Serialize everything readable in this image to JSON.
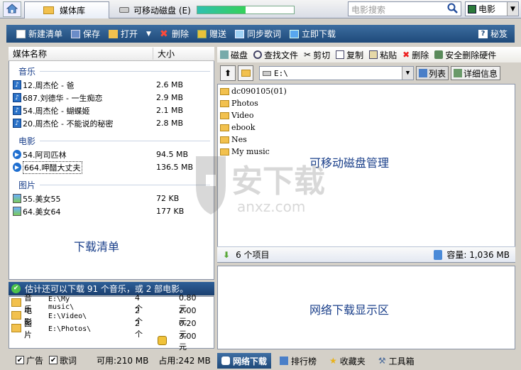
{
  "topbar": {
    "tab_library": "媒体库",
    "tab_disk": "可移动磁盘 (E)",
    "disk_usage_fraction": 0.5,
    "search_placeholder": "电影搜索",
    "category": "电影"
  },
  "toolbar": {
    "new_list": "新建清单",
    "save": "保存",
    "open": "打开",
    "delete": "删除",
    "gift": "赠送",
    "sync_lyrics": "同步歌词",
    "download_now": "立即下载",
    "tips": "秘笈"
  },
  "list": {
    "col_name": "媒体名称",
    "col_size": "大小",
    "sections": [
      {
        "title": "音乐",
        "items": [
          {
            "name": "12.周杰伦 - 爸",
            "size": "2.6 MB"
          },
          {
            "name": "687.刘德华 - 一生痴恋",
            "size": "2.9 MB"
          },
          {
            "name": "54.周杰伦 - 蝴蝶姬",
            "size": "2.1 MB"
          },
          {
            "name": "20.周杰伦 - 不能说的秘密",
            "size": "2.8 MB"
          }
        ]
      },
      {
        "title": "电影",
        "items": [
          {
            "name": "54.阿司匹林",
            "size": "94.5 MB"
          },
          {
            "name": "664.呷醋大丈夫",
            "size": "136.5 MB"
          }
        ]
      },
      {
        "title": "图片",
        "items": [
          {
            "name": "55.美女55",
            "size": "72 KB"
          },
          {
            "name": "64.美女64",
            "size": "177 KB"
          }
        ]
      }
    ],
    "area_label": "下载清单"
  },
  "estimate": {
    "text": "估计还可以下载 91 个音乐，或 2 部电影。",
    "rows": [
      {
        "type": "音乐",
        "path": "E:\\My music\\",
        "count": "4 个",
        "price": "0.80 元"
      },
      {
        "type": "电影",
        "path": "E:\\Video\\",
        "count": "2 个",
        "price": "2.00 元"
      },
      {
        "type": "图片",
        "path": "E:\\Photos\\",
        "count": "2 个",
        "price": "0.20 元"
      }
    ],
    "total": "3.00 元"
  },
  "left_status": {
    "ads": "广告",
    "lyrics": "歌词",
    "available": "可用:210 MB",
    "used": "占用:242 MB"
  },
  "right_toolbar": {
    "disk": "磁盘",
    "find": "查找文件",
    "cut": "剪切",
    "copy": "复制",
    "paste": "粘贴",
    "delete": "删除",
    "safe_remove": "安全删除硬件"
  },
  "nav": {
    "path": "E:\\",
    "view_list": "列表",
    "view_detail": "详细信息"
  },
  "files": [
    "dc090105(01)",
    "Photos",
    "Video",
    "ebook",
    "Nes",
    "My music"
  ],
  "file_area_label": "可移动磁盘管理",
  "right_status": {
    "items": "6 个项目",
    "capacity": "容量: 1,036 MB"
  },
  "net_area_label": "网络下载显示区",
  "bottom_tabs": [
    "网络下载",
    "排行榜",
    "收藏夹",
    "工具箱"
  ],
  "watermark": {
    "text": "安下载",
    "sub": "anxz.com"
  }
}
